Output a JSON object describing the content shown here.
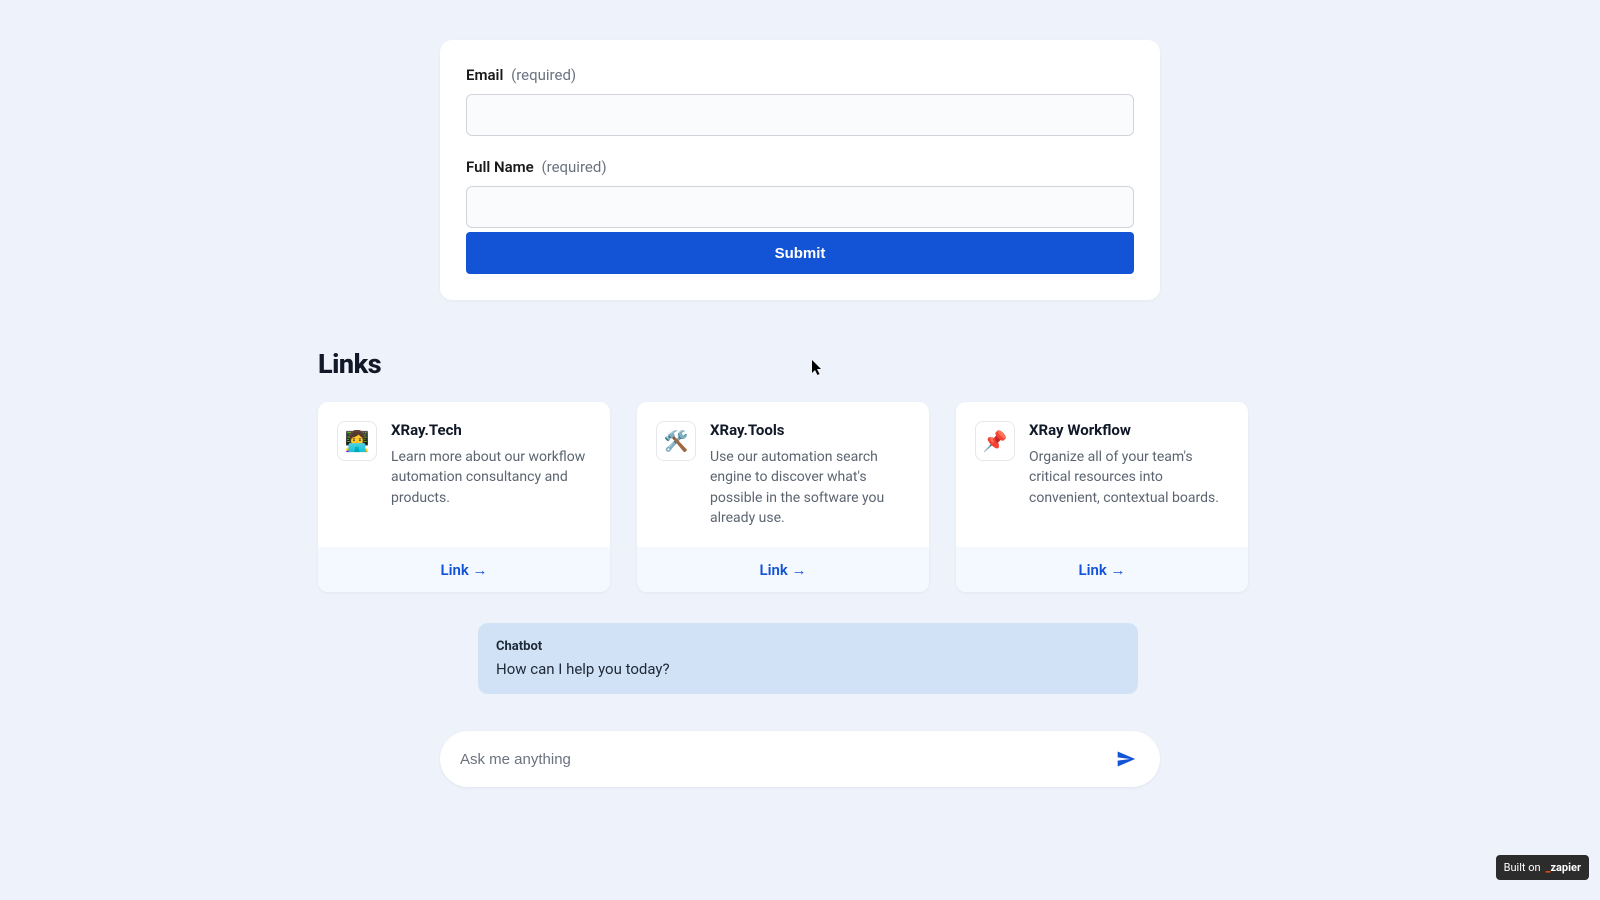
{
  "form": {
    "email": {
      "label": "Email",
      "required_text": "(required)",
      "value": ""
    },
    "full_name": {
      "label": "Full Name",
      "required_text": "(required)",
      "value": ""
    },
    "submit_label": "Submit"
  },
  "links": {
    "heading": "Links",
    "cards": [
      {
        "icon_emoji": "👩‍💻",
        "title": "XRay.Tech",
        "description": "Learn more about our workflow automation consultancy and products.",
        "link_text": "Link →"
      },
      {
        "icon_emoji": "🛠️",
        "title": "XRay.Tools",
        "description": "Use our automation search engine to discover what's possible in the software you already use.",
        "link_text": "Link →"
      },
      {
        "icon_emoji": "📌",
        "title": "XRay Workflow",
        "description": "Organize all of your team's critical resources into convenient, contextual boards.",
        "link_text": "Link →"
      }
    ]
  },
  "chatbot": {
    "label": "Chatbot",
    "message": "How can I help you today?"
  },
  "chat_input": {
    "placeholder": "Ask me anything",
    "value": ""
  },
  "footer_badge": {
    "prefix": "Built on",
    "brand_underscore": "_",
    "brand": "zapier"
  }
}
